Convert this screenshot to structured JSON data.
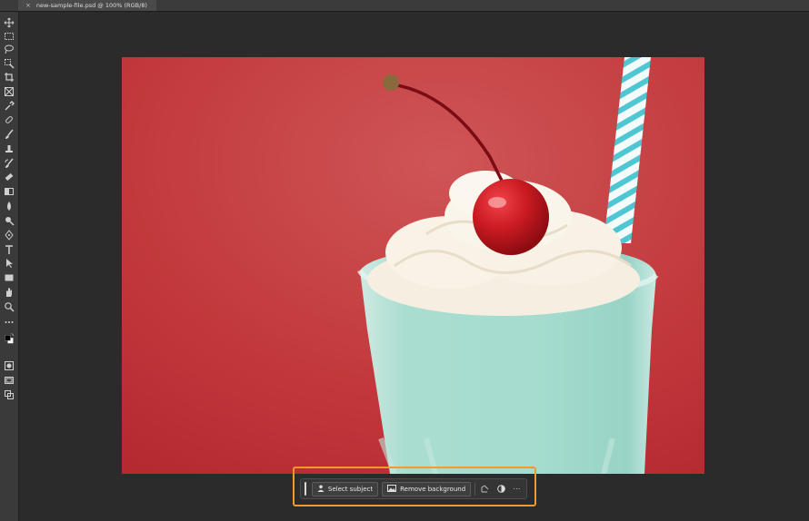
{
  "document_tab": {
    "title": "new-sample-file.psd @ 100% (RGB/8)",
    "close_icon": "close-icon"
  },
  "toolbar": {
    "tools": [
      {
        "name": "move-tool-icon"
      },
      {
        "name": "marquee-tool-icon"
      },
      {
        "name": "lasso-tool-icon"
      },
      {
        "name": "object-selection-tool-icon"
      },
      {
        "name": "crop-tool-icon"
      },
      {
        "name": "frame-tool-icon"
      },
      {
        "name": "eyedropper-tool-icon"
      },
      {
        "name": "healing-brush-tool-icon"
      },
      {
        "name": "brush-tool-icon"
      },
      {
        "name": "clone-stamp-tool-icon"
      },
      {
        "name": "history-brush-tool-icon"
      },
      {
        "name": "eraser-tool-icon"
      },
      {
        "name": "gradient-tool-icon"
      },
      {
        "name": "blur-tool-icon"
      },
      {
        "name": "dodge-tool-icon"
      },
      {
        "name": "pen-tool-icon"
      },
      {
        "name": "type-tool-icon"
      },
      {
        "name": "path-selection-tool-icon"
      },
      {
        "name": "rectangle-tool-icon"
      },
      {
        "name": "hand-tool-icon"
      },
      {
        "name": "zoom-tool-icon"
      },
      {
        "name": "more-tools-icon"
      },
      {
        "name": "color-swatches-icon"
      },
      {
        "name": "quick-mask-icon"
      },
      {
        "name": "screen-mode-icon"
      },
      {
        "name": "artboard-icon"
      }
    ],
    "foreground_color": "#000000",
    "background_color": "#ffffff"
  },
  "image": {
    "background_color": "#c2393c",
    "whipped_cream_color": "#f7f1e4",
    "cherry_color": "#cc1b22",
    "glass_color": "#a9ddd0",
    "straw_colors": [
      "#ffffff",
      "#4fc7d3"
    ]
  },
  "contextual_taskbar": {
    "highlight_color": "#f29a2e",
    "select_subject_label": "Select subject",
    "remove_background_label": "Remove background",
    "icons": [
      "select-subject-icon",
      "remove-background-icon",
      "transform-icon",
      "adjustment-icon",
      "more-options-icon"
    ],
    "more_label": "⋯"
  }
}
